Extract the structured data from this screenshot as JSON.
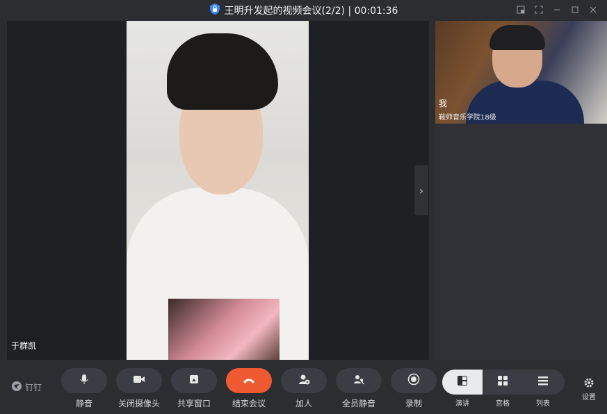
{
  "titlebar": {
    "title": "王明升发起的视频会议(2/2) | 00:01:36"
  },
  "main": {
    "speaker_name": "于群凯"
  },
  "side": {
    "self_name": "我",
    "self_subtitle": "鞍师音乐学院18级"
  },
  "bottom": {
    "logo_text": "钉钉",
    "controls": [
      {
        "label": "静音"
      },
      {
        "label": "关闭摄像头"
      },
      {
        "label": "共享窗口"
      },
      {
        "label": "结束会议"
      },
      {
        "label": "加人"
      },
      {
        "label": "全员静音"
      },
      {
        "label": "录制"
      }
    ],
    "views": [
      {
        "label": "演讲"
      },
      {
        "label": "宫格"
      },
      {
        "label": "列表"
      }
    ],
    "settings_label": "设置"
  },
  "colors": {
    "end_call": "#f05a33",
    "background": "#2b2d31"
  }
}
